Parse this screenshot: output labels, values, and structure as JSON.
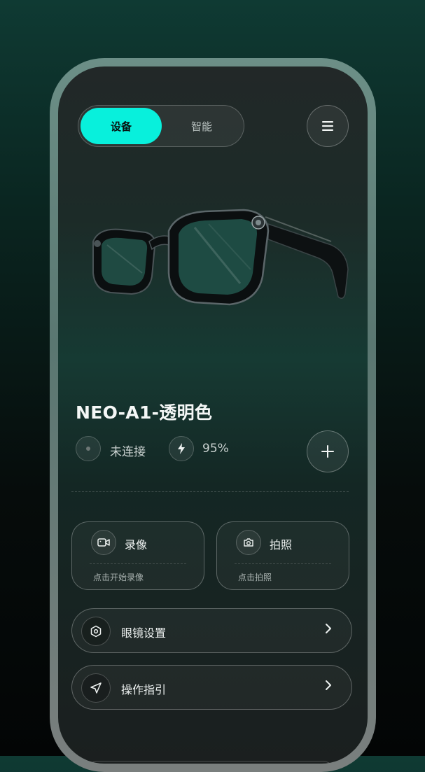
{
  "tabs": {
    "device": "设备",
    "smart": "智能"
  },
  "device": {
    "name": "NEO-A1-透明色",
    "connection_status": "未连接",
    "battery": "95%"
  },
  "cards": [
    {
      "title": "录像",
      "subtitle": "点击开始录像",
      "icon": "video-icon"
    },
    {
      "title": "拍照",
      "subtitle": "点击拍照",
      "icon": "camera-icon"
    }
  ],
  "menu_rows": [
    {
      "label": "眼镜设置",
      "icon": "settings-hexagon-icon"
    },
    {
      "label": "操作指引",
      "icon": "navigation-arrow-icon"
    }
  ],
  "colors": {
    "accent": "#08f0dc",
    "background": "#0a2520"
  }
}
